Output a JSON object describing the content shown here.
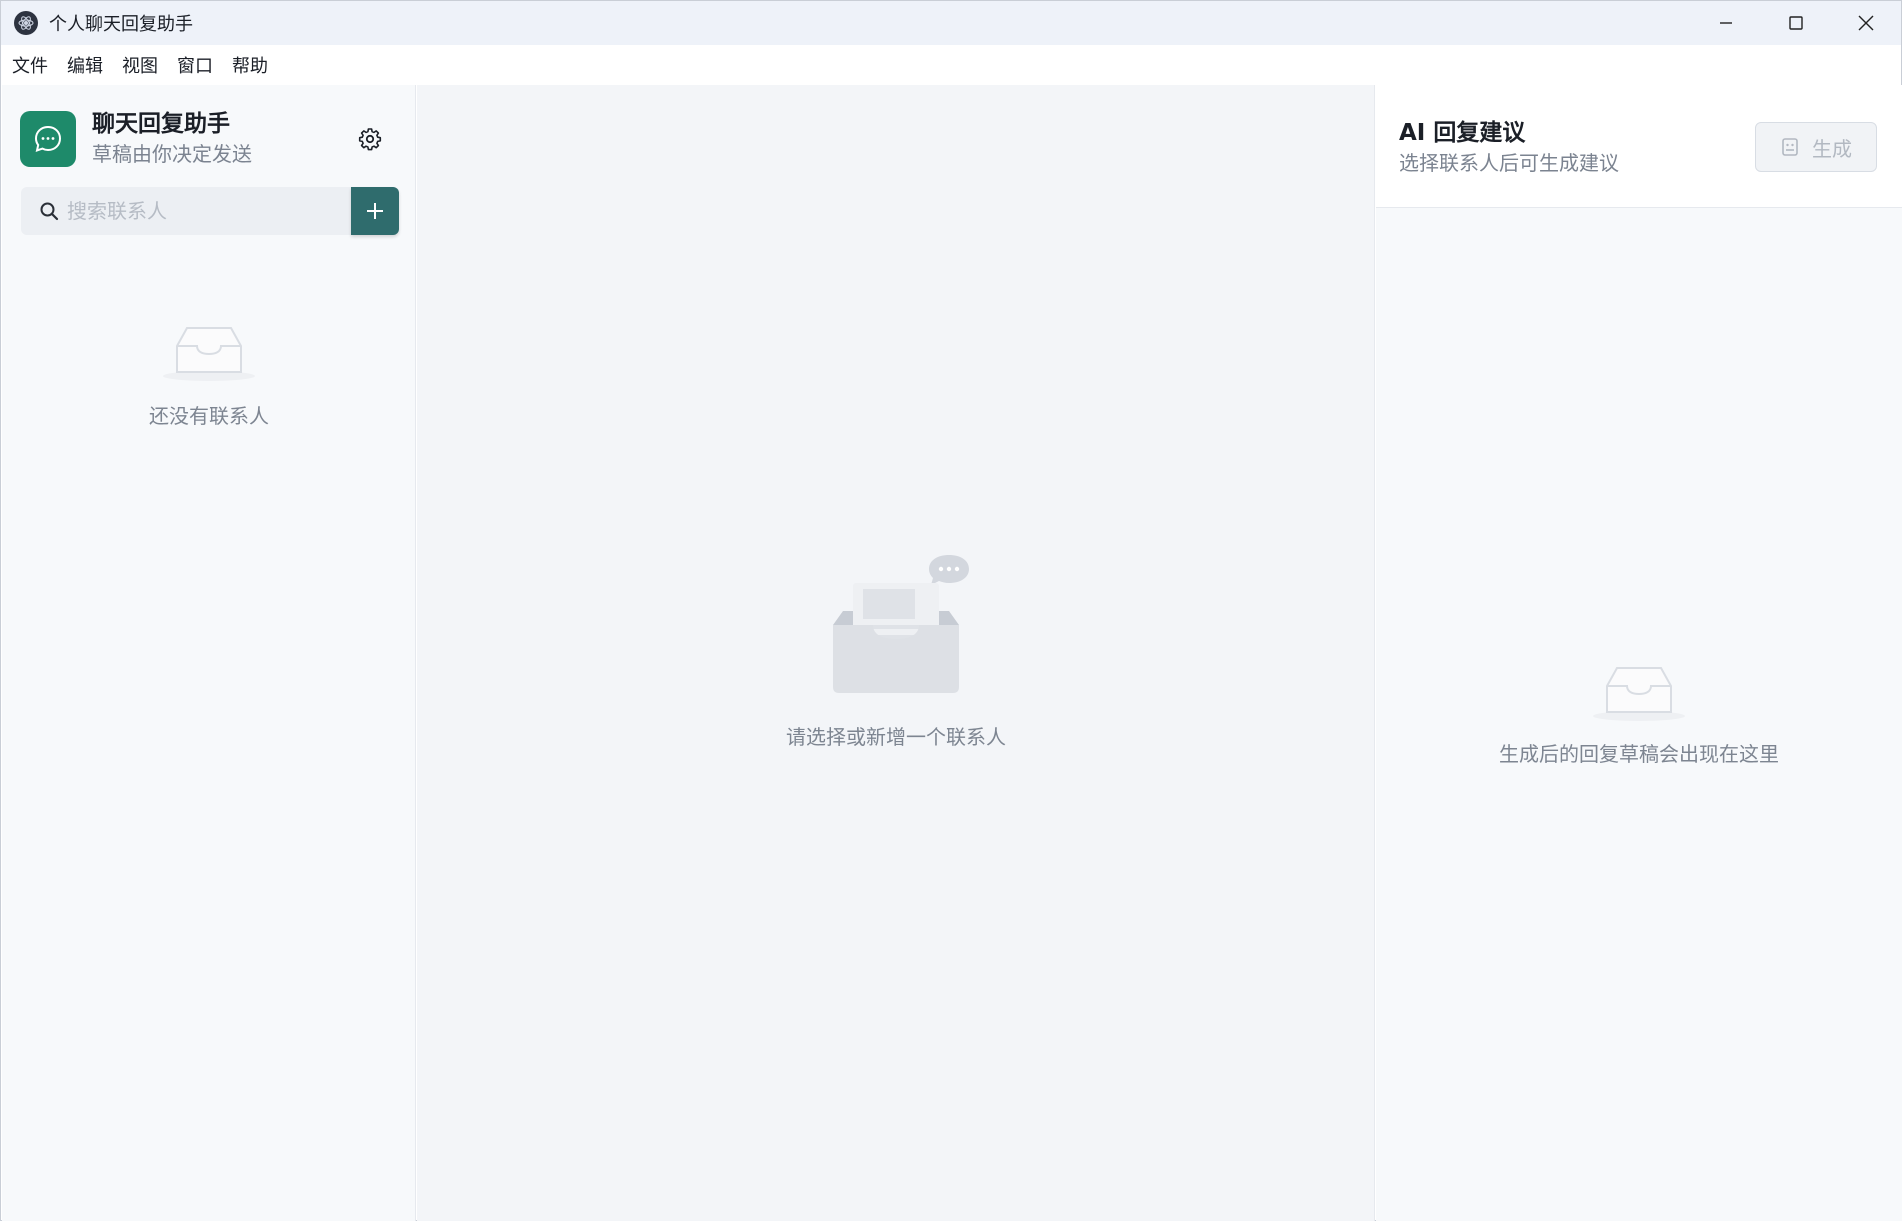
{
  "window": {
    "title": "个人聊天回复助手"
  },
  "menu": {
    "items": [
      "文件",
      "编辑",
      "视图",
      "窗口",
      "帮助"
    ]
  },
  "sidebar": {
    "brand_name": "聊天回复助手",
    "brand_subtitle": "草稿由你决定发送",
    "search_placeholder": "搜索联系人",
    "empty_text": "还没有联系人"
  },
  "main": {
    "empty_text": "请选择或新增一个联系人"
  },
  "suggestions": {
    "title": "AI 回复建议",
    "subtitle": "选择联系人后可生成建议",
    "generate_label": "生成",
    "empty_text": "生成后的回复草稿会出现在这里"
  },
  "colors": {
    "brand": "#1e8a6a",
    "add_button": "#2f6c6d"
  },
  "icons": {
    "app": "electron-logo-icon",
    "brand": "chat-bubble-icon",
    "settings": "gear-icon",
    "search": "search-icon",
    "add": "plus-icon",
    "generate": "robot-icon"
  }
}
